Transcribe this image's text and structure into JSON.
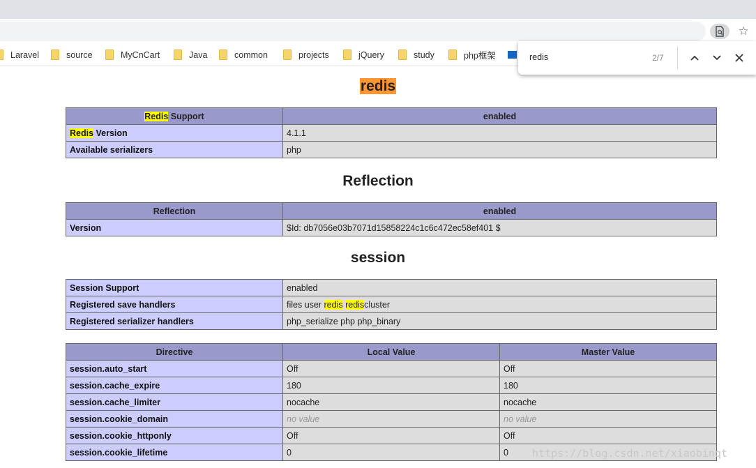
{
  "bookmarks": [
    "Laravel",
    "source",
    "MyCnCart",
    "Java",
    "common",
    "projects",
    "jQuery",
    "study",
    "php框架"
  ],
  "find": {
    "query": "redis",
    "count": "2/7"
  },
  "redis": {
    "title": "redis",
    "header_left_hl": "Redis",
    "header_left_rest": " Support",
    "header_right": "enabled",
    "version_label_hl": "Redis",
    "version_label_rest": " Version",
    "version_value": "4.1.1",
    "serializers_label": "Available serializers",
    "serializers_value": "php"
  },
  "reflection": {
    "title": "Reflection",
    "header_left": "Reflection",
    "header_right": "enabled",
    "version_label": "Version",
    "version_value": "$Id: db7056e03b7071d15858224c1c6c472ec58ef401 $"
  },
  "session": {
    "title": "session",
    "support_label": "Session Support",
    "support_value": "enabled",
    "handlers_label": "Registered save handlers",
    "handlers_pre": "files user ",
    "handlers_hl1": "redis",
    "handlers_mid": " ",
    "handlers_hl2": "redis",
    "handlers_post": "cluster",
    "serializer_label": "Registered serializer handlers",
    "serializer_value": "php_serialize php php_binary",
    "directive_headers": [
      "Directive",
      "Local Value",
      "Master Value"
    ],
    "directives": [
      {
        "name": "session.auto_start",
        "local": "Off",
        "master": "Off"
      },
      {
        "name": "session.cache_expire",
        "local": "180",
        "master": "180"
      },
      {
        "name": "session.cache_limiter",
        "local": "nocache",
        "master": "nocache"
      },
      {
        "name": "session.cookie_domain",
        "local": "no value",
        "master": "no value"
      },
      {
        "name": "session.cookie_httponly",
        "local": "Off",
        "master": "Off"
      },
      {
        "name": "session.cookie_lifetime",
        "local": "0",
        "master": "0"
      }
    ]
  },
  "watermark": "https://blog.csdn.net/xiaobinqt"
}
